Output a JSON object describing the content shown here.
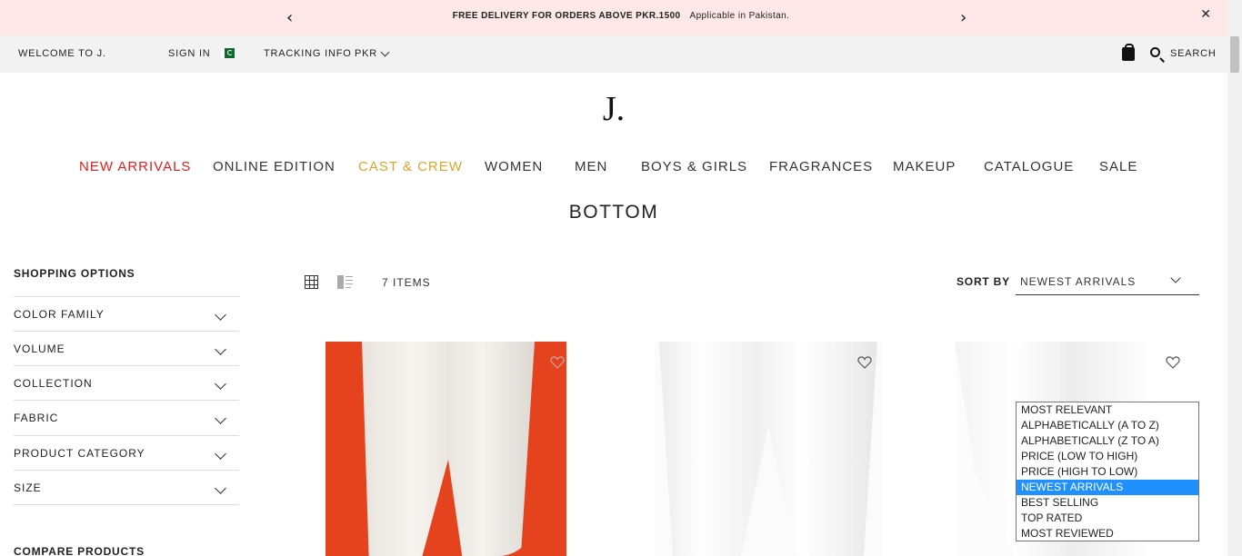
{
  "promo": {
    "bold_text": "FREE DELIVERY FOR ORDERS ABOVE PKR.1500",
    "text": "Applicable in Pakistan.",
    "prev_glyph": "‹",
    "next_glyph": "›",
    "close_glyph": "✕"
  },
  "utility": {
    "welcome": "WELCOME TO J.",
    "sign_in": "SIGN IN",
    "tracking": "TRACKING INFO",
    "currency": "PKR",
    "search": "SEARCH"
  },
  "logo": "J.",
  "nav": [
    {
      "label": "NEW ARRIVALS"
    },
    {
      "label": "ONLINE EDITION"
    },
    {
      "label": "CAST & CREW"
    },
    {
      "label": "WOMEN"
    },
    {
      "label": "MEN"
    },
    {
      "label": "BOYS & GIRLS"
    },
    {
      "label": "FRAGRANCES"
    },
    {
      "label": "MAKEUP"
    },
    {
      "label": "CATALOGUE"
    },
    {
      "label": "SALE"
    }
  ],
  "page_title": "BOTTOM",
  "sidebar": {
    "heading": "SHOPPING OPTIONS",
    "filters": [
      {
        "label": "COLOR FAMILY"
      },
      {
        "label": "VOLUME"
      },
      {
        "label": "COLLECTION"
      },
      {
        "label": "FABRIC"
      },
      {
        "label": "PRODUCT CATEGORY"
      },
      {
        "label": "SIZE"
      }
    ],
    "compare": "COMPARE PRODUCTS"
  },
  "toolbar": {
    "items_count": "7 ITEMS",
    "sort_label": "SORT BY",
    "sort_value": "NEWEST ARRIVALS"
  },
  "sort_options": [
    {
      "label": "MOST RELEVANT"
    },
    {
      "label": "ALPHABETICALLY (A TO Z)"
    },
    {
      "label": "ALPHABETICALLY (Z TO A)"
    },
    {
      "label": "PRICE (LOW TO HIGH)"
    },
    {
      "label": "PRICE (HIGH TO LOW)"
    },
    {
      "label": "NEWEST ARRIVALS"
    },
    {
      "label": "BEST SELLING"
    },
    {
      "label": "TOP RATED"
    },
    {
      "label": "MOST REVIEWED"
    }
  ],
  "colors": {
    "promo_bg": "#fde7e7",
    "new_arrivals": "#e01e1e",
    "cast_crew": "#d9a52c",
    "selected_option": "#1e90ff"
  }
}
